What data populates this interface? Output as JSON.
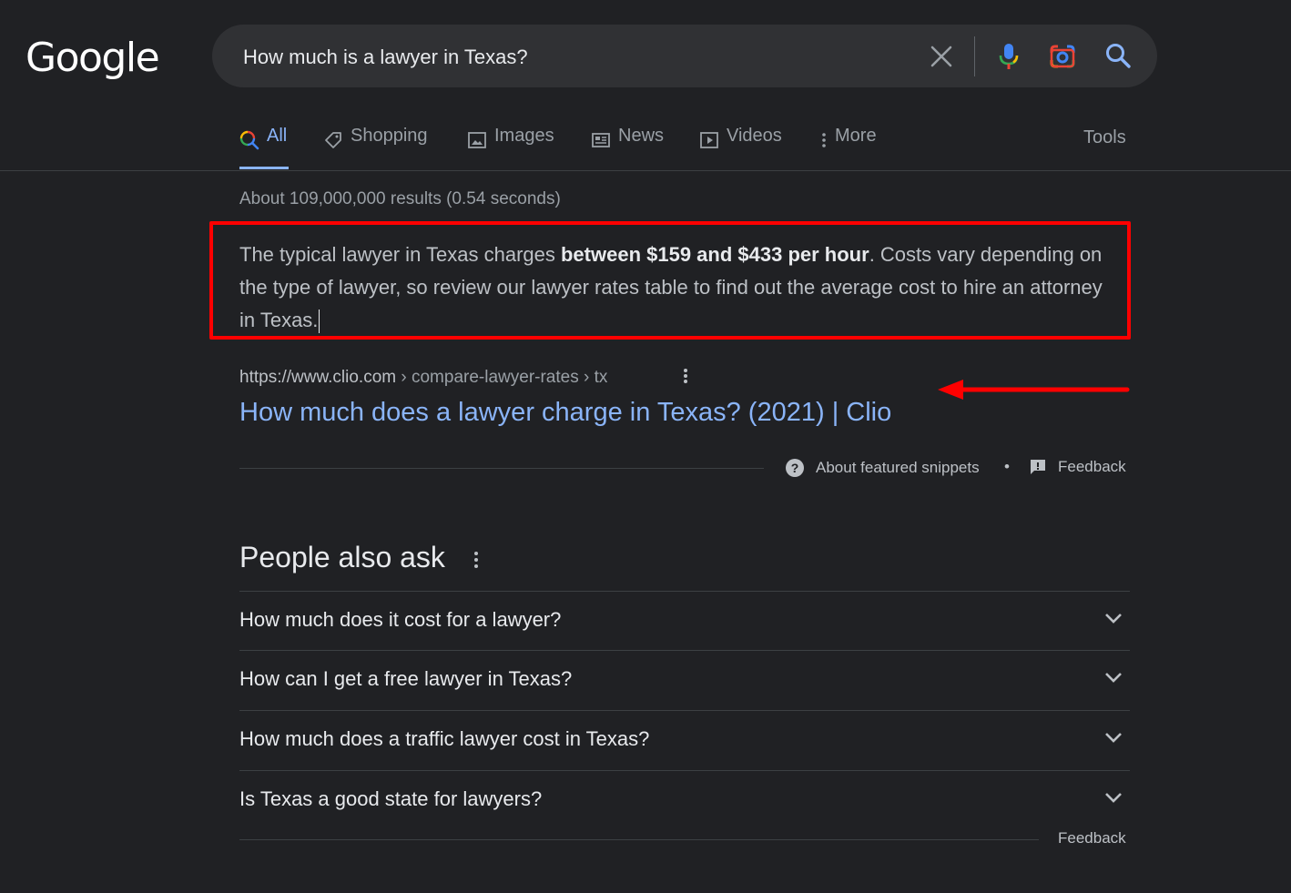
{
  "logo": "Google",
  "search": {
    "query": "How much is a lawyer in Texas?"
  },
  "tabs": {
    "all": "All",
    "shopping": "Shopping",
    "images": "Images",
    "news": "News",
    "videos": "Videos",
    "more": "More"
  },
  "tools_label": "Tools",
  "result_stats": "About 109,000,000 results (0.54 seconds)",
  "featured_snippet": {
    "text_before": "The typical lawyer in Texas charges ",
    "text_bold": "between $159 and $433 per hour",
    "text_after": ". Costs vary depending on the type of lawyer, so review our lawyer rates table to find out the average cost to hire an attorney in Texas.",
    "url_domain": "https://www.clio.com",
    "url_crumbs": " › compare-lawyer-rates › tx",
    "title": "How much does a lawyer charge in Texas? (2021) | Clio",
    "about_label": "About featured snippets",
    "separator": "•",
    "feedback_label": "Feedback"
  },
  "people_also_ask": {
    "title": "People also ask",
    "questions": [
      "How much does it cost for a lawyer?",
      "How can I get a free lawyer in Texas?",
      "How much does a traffic lawyer cost in Texas?",
      "Is Texas a good state for lawyers?"
    ],
    "feedback_label": "Feedback"
  },
  "annotation_colors": {
    "highlight_box": "#ff0000",
    "arrow": "#ff0000"
  },
  "colors": {
    "background": "#202124",
    "link": "#8ab4f8",
    "text": "#bdc1c6"
  }
}
